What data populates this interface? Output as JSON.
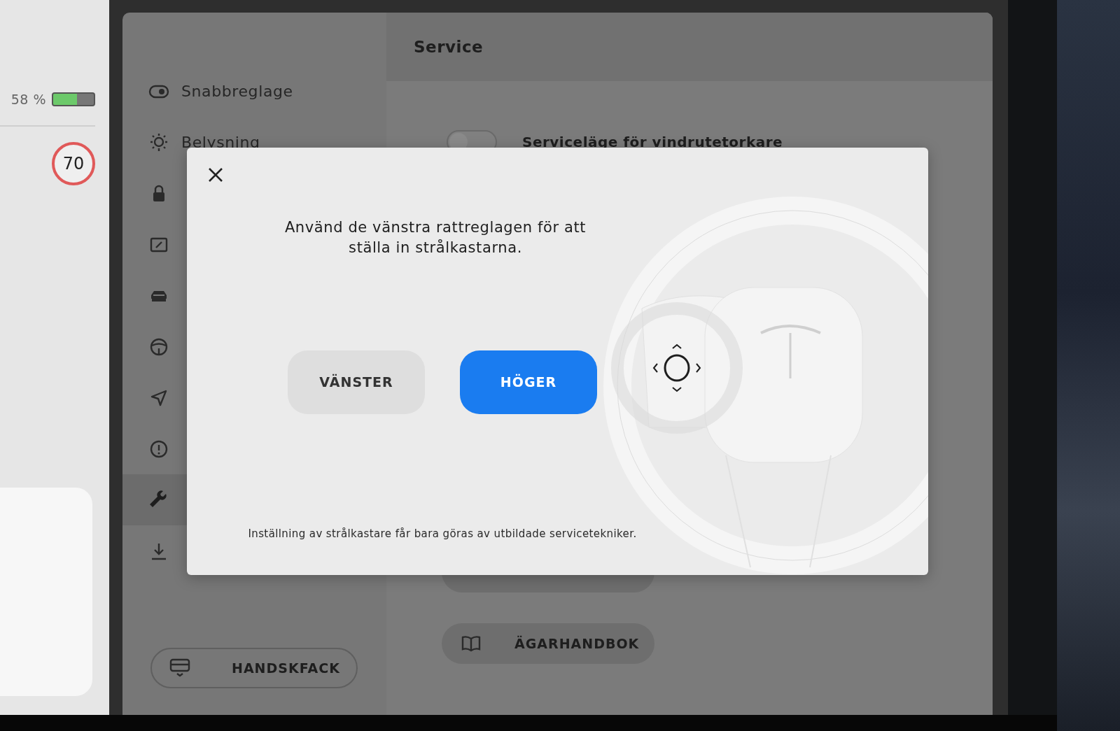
{
  "sidebar": {
    "battery": {
      "reading": "58 %",
      "level": 0.58
    },
    "speed_limit": "70"
  },
  "nav": {
    "items": [
      {
        "label": "Snabbreglage",
        "selected": false
      },
      {
        "label": "Belysning",
        "selected": false
      },
      {
        "selected": false
      },
      {
        "selected": false
      },
      {
        "selected": false
      },
      {
        "selected": false
      },
      {
        "selected": false
      },
      {
        "selected": false
      },
      {
        "selected": true
      },
      {
        "selected": false
      }
    ]
  },
  "glovebox_button": {
    "label": "HANDSKFACK"
  },
  "content": {
    "title": "Service",
    "wiper_service": {
      "label": "Serviceläge för vindrutetorkare",
      "on": false
    },
    "buttons": [
      {
        "kind": "covered"
      },
      {
        "kind": "book",
        "label": "ÄGARHANDBOK"
      }
    ]
  },
  "dialog": {
    "message": "Använd de vänstra rattreglagen för att ställa in strålkastarna.",
    "options": [
      {
        "label": "VÄNSTER",
        "selected": false
      },
      {
        "label": "HÖGER",
        "selected": true
      }
    ],
    "note": "Inställning av strålkastare får bara göras av utbildade servicetekniker."
  }
}
